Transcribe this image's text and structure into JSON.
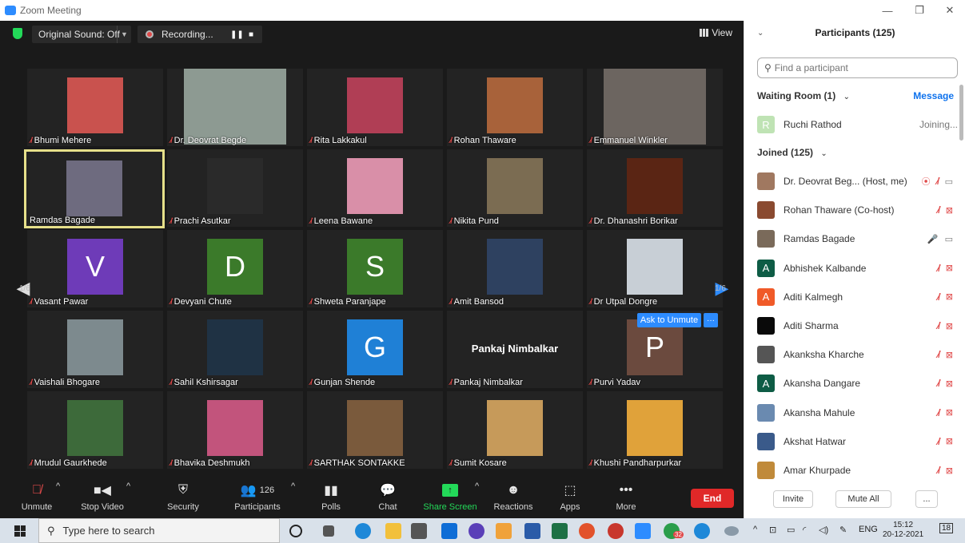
{
  "window": {
    "title": "Zoom Meeting"
  },
  "topbar": {
    "original_sound": "Original Sound: Off",
    "recording": "Recording...",
    "view": "View"
  },
  "tiles": [
    {
      "name": "Bhumi Mehere",
      "muted": true,
      "kind": "photo",
      "bg": "#c9524e"
    },
    {
      "name": "Dr. Deovrat Begde",
      "muted": true,
      "kind": "wide",
      "bg": "#8d9a92"
    },
    {
      "name": "Rita Lakkakul",
      "muted": true,
      "kind": "photo",
      "bg": "#b03e55"
    },
    {
      "name": "Rohan Thaware",
      "muted": true,
      "kind": "photo",
      "bg": "#a8623a"
    },
    {
      "name": "Emmanuel Winkler",
      "muted": true,
      "kind": "wide",
      "bg": "#6c6560"
    },
    {
      "name": "Ramdas Bagade",
      "muted": false,
      "kind": "photo",
      "bg": "#6e6b7f",
      "active": true
    },
    {
      "name": "Prachi Asutkar",
      "muted": true,
      "kind": "photo",
      "bg": "#2a2a2a"
    },
    {
      "name": "Leena Bawane",
      "muted": true,
      "kind": "photo",
      "bg": "#d98fa8"
    },
    {
      "name": "Nikita Pund",
      "muted": true,
      "kind": "photo",
      "bg": "#7b6c52"
    },
    {
      "name": "Dr. Dhanashri Borikar",
      "muted": true,
      "kind": "photo",
      "bg": "#5a2514"
    },
    {
      "name": "Vasant Pawar",
      "muted": true,
      "kind": "avatar",
      "letter": "V",
      "bg": "#6e3bb8"
    },
    {
      "name": "Devyani Chute",
      "muted": true,
      "kind": "avatar",
      "letter": "D",
      "bg": "#3b7a2a"
    },
    {
      "name": "Shweta Paranjape",
      "muted": true,
      "kind": "avatar",
      "letter": "S",
      "bg": "#3b7a2a"
    },
    {
      "name": "Amit Bansod",
      "muted": true,
      "kind": "photo",
      "bg": "#2e4160"
    },
    {
      "name": "Dr Utpal Dongre",
      "muted": true,
      "kind": "photo",
      "bg": "#c8cfd6"
    },
    {
      "name": "Vaishali Bhogare",
      "muted": true,
      "kind": "photo",
      "bg": "#7d8a8e"
    },
    {
      "name": "Sahil Kshirsagar",
      "muted": true,
      "kind": "photo",
      "bg": "#1f3244"
    },
    {
      "name": "Gunjan Shende",
      "muted": true,
      "kind": "avatar",
      "letter": "G",
      "bg": "#1f80d6"
    },
    {
      "name": "Pankaj Nimbalkar",
      "muted": true,
      "kind": "text",
      "bg": "#232323"
    },
    {
      "name": "Purvi Yadav",
      "muted": true,
      "kind": "avatar",
      "letter": "P",
      "bg": "#6b4a3e"
    },
    {
      "name": "Mrudul Gaurkhede",
      "muted": true,
      "kind": "photo",
      "bg": "#3d6a3a"
    },
    {
      "name": "Bhavika Deshmukh",
      "muted": true,
      "kind": "photo",
      "bg": "#c2547c"
    },
    {
      "name": "SARTHAK SONTAKKE",
      "muted": true,
      "kind": "photo",
      "bg": "#7a5a3c"
    },
    {
      "name": "Sumit Kosare",
      "muted": true,
      "kind": "photo",
      "bg": "#c69a5a"
    },
    {
      "name": "Khushi Pandharpurkar",
      "muted": true,
      "kind": "photo",
      "bg": "#e0a23a"
    }
  ],
  "pager": {
    "left": "1/6",
    "right": "1/6"
  },
  "unmute": {
    "label": "Ask to Unmute",
    "more": "···"
  },
  "toolbar": {
    "unmute": "Unmute",
    "stop_video": "Stop Video",
    "security": "Security",
    "participants": "Participants",
    "participants_count": "126",
    "polls": "Polls",
    "chat": "Chat",
    "share_screen": "Share Screen",
    "reactions": "Reactions",
    "apps": "Apps",
    "more": "More",
    "end": "End"
  },
  "panel": {
    "title": "Participants (125)",
    "search_placeholder": "Find a participant",
    "waiting_room": "Waiting Room (1)",
    "message": "Message",
    "joined": "Joined (125)",
    "waiting": [
      {
        "name": "Ruchi Rathod",
        "status": "Joining...",
        "initial": "R",
        "color": "#bfe3b4"
      }
    ],
    "participants": [
      {
        "name": "Dr. Deovrat Beg...  (Host, me)",
        "icon": "photo",
        "color": "#a07860",
        "recording": true,
        "mic": "off",
        "cam": "on"
      },
      {
        "name": "Rohan Thaware (Co-host)",
        "icon": "photo",
        "color": "#8a4a30",
        "mic": "off",
        "cam": "off"
      },
      {
        "name": "Ramdas Bagade",
        "icon": "photo",
        "color": "#7a6a5a",
        "mic": "on",
        "cam": "on"
      },
      {
        "name": "Abhishek Kalbande",
        "icon": "letter",
        "initial": "A",
        "color": "#0e5c45",
        "mic": "off",
        "cam": "off"
      },
      {
        "name": "Aditi Kalmegh",
        "icon": "letter",
        "initial": "A",
        "color": "#f05a28",
        "mic": "off",
        "cam": "off"
      },
      {
        "name": "Aditi Sharma",
        "icon": "photo",
        "color": "#0a0a0a",
        "mic": "off",
        "cam": "off"
      },
      {
        "name": "Akanksha Kharche",
        "icon": "photo",
        "color": "#555555",
        "mic": "off",
        "cam": "off"
      },
      {
        "name": "Akansha Dangare",
        "icon": "letter",
        "initial": "A",
        "color": "#0e5c45",
        "mic": "off",
        "cam": "off"
      },
      {
        "name": "Akansha Mahule",
        "icon": "photo",
        "color": "#6a8ab0",
        "mic": "off",
        "cam": "off"
      },
      {
        "name": "Akshat Hatwar",
        "icon": "photo",
        "color": "#3a5a8a",
        "mic": "off",
        "cam": "off"
      },
      {
        "name": "Amar Khurpade",
        "icon": "photo",
        "color": "#c08a3a",
        "mic": "off",
        "cam": "off"
      }
    ],
    "invite": "Invite",
    "mute_all": "Mute All",
    "more": "..."
  },
  "taskbar": {
    "search_placeholder": "Type here to search",
    "lang": "ENG",
    "time": "15:12",
    "date": "20-12-2021",
    "notif_count": "18",
    "badge_count": "32"
  }
}
